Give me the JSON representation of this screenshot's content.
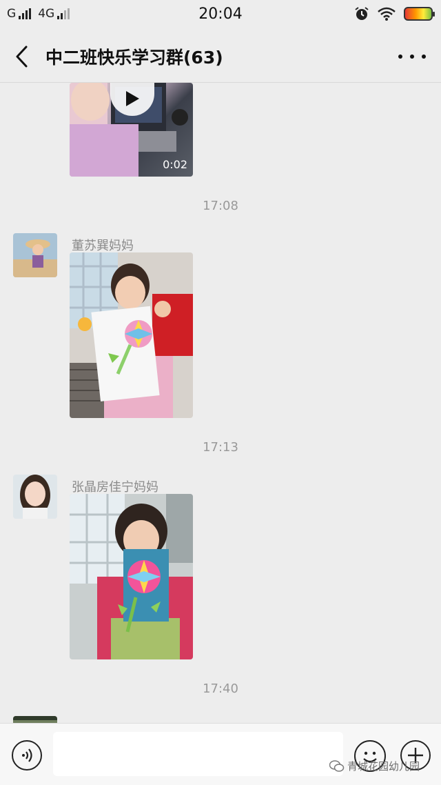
{
  "status_bar": {
    "carrier1": "G",
    "carrier2": "4G",
    "time": "20:04",
    "icons": [
      "signal-icon",
      "alarm-icon",
      "wifi-icon",
      "battery-icon"
    ]
  },
  "header": {
    "title": "中二班快乐学习群(63)",
    "back_icon": "chevron-left-icon",
    "more_icon": "more-dots-icon"
  },
  "messages": [
    {
      "type": "video",
      "duration": "0:02"
    },
    {
      "type": "timestamp",
      "text": "17:08"
    },
    {
      "type": "image",
      "sender": "董苏巽妈妈"
    },
    {
      "type": "timestamp",
      "text": "17:13"
    },
    {
      "type": "image",
      "sender": "张晶房佳宁妈妈"
    },
    {
      "type": "timestamp",
      "text": "17:40"
    }
  ],
  "input_bar": {
    "voice_icon": "voice-icon",
    "emoji_icon": "emoji-icon",
    "plus_icon": "plus-icon",
    "placeholder": ""
  },
  "watermark": {
    "text": "青城花园幼儿园",
    "icon": "wechat-icon"
  },
  "colors": {
    "background": "#ededed",
    "timestamp": "#999999",
    "sender": "#8a8a8a",
    "input_bar": "#f7f7f7"
  }
}
